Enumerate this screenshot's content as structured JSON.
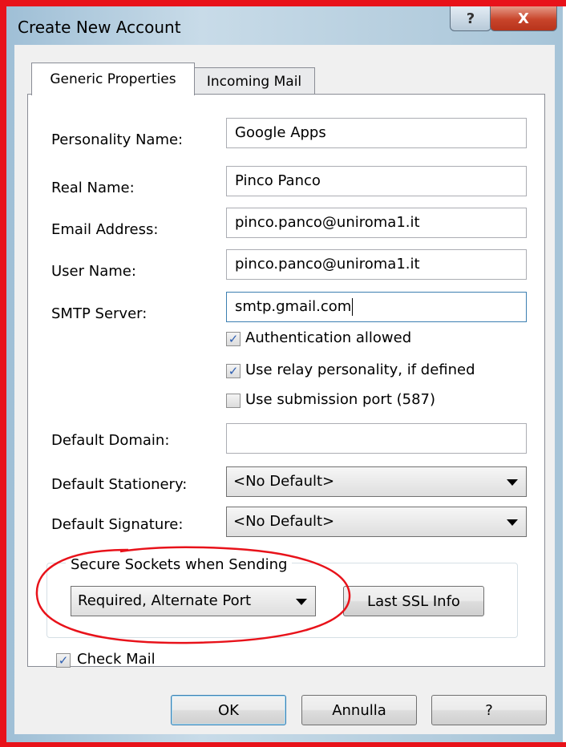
{
  "window": {
    "title": "Create New Account",
    "help_glyph": "?",
    "close_glyph": "X"
  },
  "tabs": [
    {
      "label": "Generic Properties",
      "active": true
    },
    {
      "label": "Incoming Mail",
      "active": false
    }
  ],
  "form": {
    "personality_name": {
      "label": "Personality Name:",
      "value": "Google Apps"
    },
    "real_name": {
      "label": "Real Name:",
      "value": "Pinco Panco"
    },
    "email_address": {
      "label": "Email Address:",
      "value": "pinco.panco@uniroma1.it"
    },
    "user_name": {
      "label": "User Name:",
      "value": "pinco.panco@uniroma1.it"
    },
    "smtp_server": {
      "label": "SMTP Server:",
      "value": "smtp.gmail.com"
    },
    "checkboxes": [
      {
        "label": "Authentication allowed",
        "checked": true
      },
      {
        "label": "Use relay personality, if defined",
        "checked": true
      },
      {
        "label": "Use submission port (587)",
        "checked": false
      }
    ],
    "default_domain": {
      "label": "Default Domain:",
      "value": ""
    },
    "default_stationery": {
      "label": "Default Stationery:",
      "value": "<No Default>"
    },
    "default_signature": {
      "label": "Default Signature:",
      "value": "<No Default>"
    }
  },
  "secure_sockets": {
    "title": "Secure Sockets when Sending",
    "value": "Required, Alternate Port",
    "ssl_info_label": "Last SSL Info"
  },
  "check_mail": {
    "label": "Check Mail",
    "checked": true
  },
  "buttons": {
    "ok": "OK",
    "cancel": "Annulla",
    "help": "?"
  },
  "annotation_color": "#e8121a",
  "check_glyph": "✓"
}
